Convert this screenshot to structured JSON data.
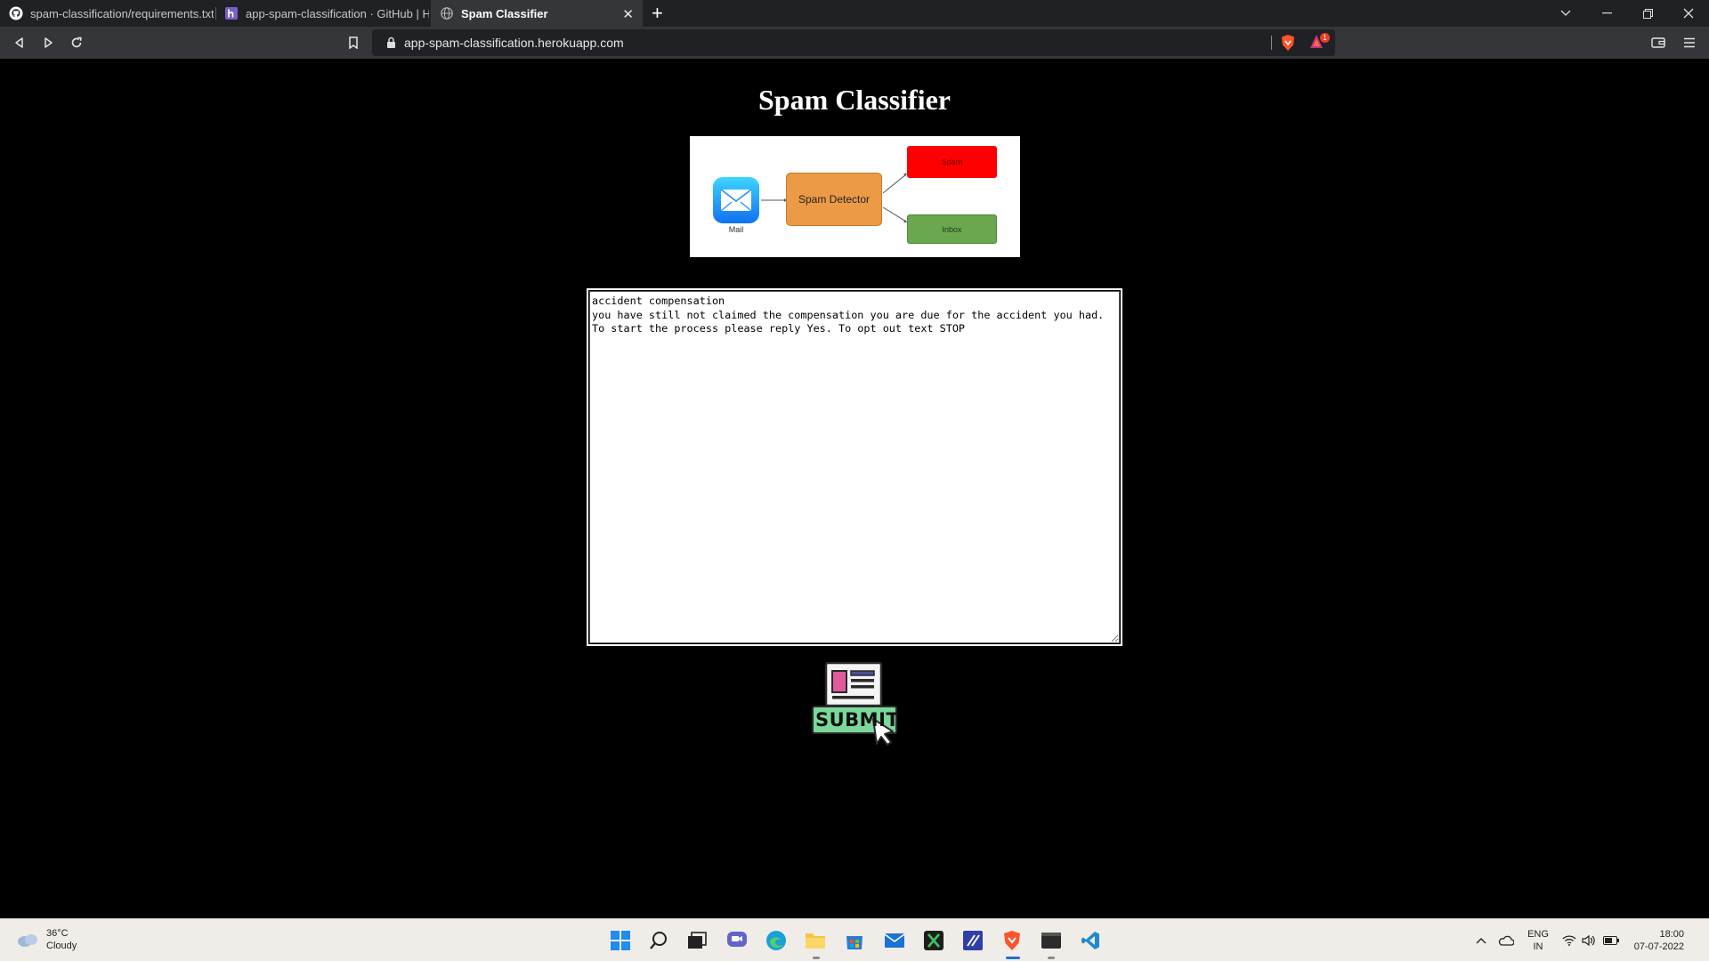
{
  "browser": {
    "tabs": [
      {
        "title": "spam-classification/requirements.txt a",
        "icon": "github-icon",
        "active": false
      },
      {
        "title": "app-spam-classification · GitHub | Her",
        "icon": "heroku-icon",
        "active": false
      },
      {
        "title": "Spam Classifier",
        "icon": "globe-icon",
        "active": true
      }
    ],
    "close_tab": "✕",
    "new_tab": "+",
    "url": "app-spam-classification.herokuapp.com"
  },
  "page": {
    "title": "Spam Classifier",
    "diagram": {
      "mail_label": "Mail",
      "detector_label": "Spam Detector",
      "spam_label": "Spam",
      "inbox_label": "Inbox"
    },
    "message": {
      "value": "accident compensation\nyou have still not claimed the compensation you are due for the accident you had.\nTo start the process please reply Yes. To opt out text STOP"
    },
    "submit_label": "SUBMIT"
  },
  "taskbar": {
    "weather_temp": "36°C",
    "weather_desc": "Cloudy",
    "lang_top": "ENG",
    "lang_bottom": "IN",
    "time": "18:00",
    "date": "07-07-2022",
    "notification_count": "1"
  },
  "colors": {
    "accent_orange": "#ec9a45",
    "spam_red": "#ff0000",
    "inbox_green": "#6aa84f",
    "submit_green": "#7bd89a"
  }
}
